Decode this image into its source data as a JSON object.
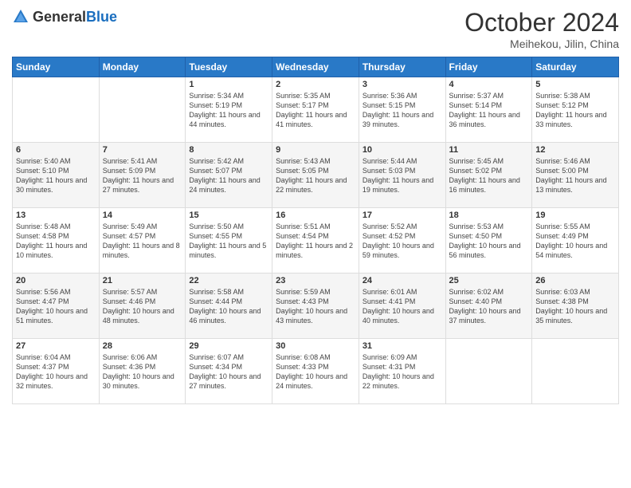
{
  "header": {
    "logo_general": "General",
    "logo_blue": "Blue",
    "title": "October 2024",
    "location": "Meihekou, Jilin, China"
  },
  "days_of_week": [
    "Sunday",
    "Monday",
    "Tuesday",
    "Wednesday",
    "Thursday",
    "Friday",
    "Saturday"
  ],
  "weeks": [
    [
      null,
      null,
      {
        "day": "1",
        "sunrise": "Sunrise: 5:34 AM",
        "sunset": "Sunset: 5:19 PM",
        "daylight": "Daylight: 11 hours and 44 minutes."
      },
      {
        "day": "2",
        "sunrise": "Sunrise: 5:35 AM",
        "sunset": "Sunset: 5:17 PM",
        "daylight": "Daylight: 11 hours and 41 minutes."
      },
      {
        "day": "3",
        "sunrise": "Sunrise: 5:36 AM",
        "sunset": "Sunset: 5:15 PM",
        "daylight": "Daylight: 11 hours and 39 minutes."
      },
      {
        "day": "4",
        "sunrise": "Sunrise: 5:37 AM",
        "sunset": "Sunset: 5:14 PM",
        "daylight": "Daylight: 11 hours and 36 minutes."
      },
      {
        "day": "5",
        "sunrise": "Sunrise: 5:38 AM",
        "sunset": "Sunset: 5:12 PM",
        "daylight": "Daylight: 11 hours and 33 minutes."
      }
    ],
    [
      {
        "day": "6",
        "sunrise": "Sunrise: 5:40 AM",
        "sunset": "Sunset: 5:10 PM",
        "daylight": "Daylight: 11 hours and 30 minutes."
      },
      {
        "day": "7",
        "sunrise": "Sunrise: 5:41 AM",
        "sunset": "Sunset: 5:09 PM",
        "daylight": "Daylight: 11 hours and 27 minutes."
      },
      {
        "day": "8",
        "sunrise": "Sunrise: 5:42 AM",
        "sunset": "Sunset: 5:07 PM",
        "daylight": "Daylight: 11 hours and 24 minutes."
      },
      {
        "day": "9",
        "sunrise": "Sunrise: 5:43 AM",
        "sunset": "Sunset: 5:05 PM",
        "daylight": "Daylight: 11 hours and 22 minutes."
      },
      {
        "day": "10",
        "sunrise": "Sunrise: 5:44 AM",
        "sunset": "Sunset: 5:03 PM",
        "daylight": "Daylight: 11 hours and 19 minutes."
      },
      {
        "day": "11",
        "sunrise": "Sunrise: 5:45 AM",
        "sunset": "Sunset: 5:02 PM",
        "daylight": "Daylight: 11 hours and 16 minutes."
      },
      {
        "day": "12",
        "sunrise": "Sunrise: 5:46 AM",
        "sunset": "Sunset: 5:00 PM",
        "daylight": "Daylight: 11 hours and 13 minutes."
      }
    ],
    [
      {
        "day": "13",
        "sunrise": "Sunrise: 5:48 AM",
        "sunset": "Sunset: 4:58 PM",
        "daylight": "Daylight: 11 hours and 10 minutes."
      },
      {
        "day": "14",
        "sunrise": "Sunrise: 5:49 AM",
        "sunset": "Sunset: 4:57 PM",
        "daylight": "Daylight: 11 hours and 8 minutes."
      },
      {
        "day": "15",
        "sunrise": "Sunrise: 5:50 AM",
        "sunset": "Sunset: 4:55 PM",
        "daylight": "Daylight: 11 hours and 5 minutes."
      },
      {
        "day": "16",
        "sunrise": "Sunrise: 5:51 AM",
        "sunset": "Sunset: 4:54 PM",
        "daylight": "Daylight: 11 hours and 2 minutes."
      },
      {
        "day": "17",
        "sunrise": "Sunrise: 5:52 AM",
        "sunset": "Sunset: 4:52 PM",
        "daylight": "Daylight: 10 hours and 59 minutes."
      },
      {
        "day": "18",
        "sunrise": "Sunrise: 5:53 AM",
        "sunset": "Sunset: 4:50 PM",
        "daylight": "Daylight: 10 hours and 56 minutes."
      },
      {
        "day": "19",
        "sunrise": "Sunrise: 5:55 AM",
        "sunset": "Sunset: 4:49 PM",
        "daylight": "Daylight: 10 hours and 54 minutes."
      }
    ],
    [
      {
        "day": "20",
        "sunrise": "Sunrise: 5:56 AM",
        "sunset": "Sunset: 4:47 PM",
        "daylight": "Daylight: 10 hours and 51 minutes."
      },
      {
        "day": "21",
        "sunrise": "Sunrise: 5:57 AM",
        "sunset": "Sunset: 4:46 PM",
        "daylight": "Daylight: 10 hours and 48 minutes."
      },
      {
        "day": "22",
        "sunrise": "Sunrise: 5:58 AM",
        "sunset": "Sunset: 4:44 PM",
        "daylight": "Daylight: 10 hours and 46 minutes."
      },
      {
        "day": "23",
        "sunrise": "Sunrise: 5:59 AM",
        "sunset": "Sunset: 4:43 PM",
        "daylight": "Daylight: 10 hours and 43 minutes."
      },
      {
        "day": "24",
        "sunrise": "Sunrise: 6:01 AM",
        "sunset": "Sunset: 4:41 PM",
        "daylight": "Daylight: 10 hours and 40 minutes."
      },
      {
        "day": "25",
        "sunrise": "Sunrise: 6:02 AM",
        "sunset": "Sunset: 4:40 PM",
        "daylight": "Daylight: 10 hours and 37 minutes."
      },
      {
        "day": "26",
        "sunrise": "Sunrise: 6:03 AM",
        "sunset": "Sunset: 4:38 PM",
        "daylight": "Daylight: 10 hours and 35 minutes."
      }
    ],
    [
      {
        "day": "27",
        "sunrise": "Sunrise: 6:04 AM",
        "sunset": "Sunset: 4:37 PM",
        "daylight": "Daylight: 10 hours and 32 minutes."
      },
      {
        "day": "28",
        "sunrise": "Sunrise: 6:06 AM",
        "sunset": "Sunset: 4:36 PM",
        "daylight": "Daylight: 10 hours and 30 minutes."
      },
      {
        "day": "29",
        "sunrise": "Sunrise: 6:07 AM",
        "sunset": "Sunset: 4:34 PM",
        "daylight": "Daylight: 10 hours and 27 minutes."
      },
      {
        "day": "30",
        "sunrise": "Sunrise: 6:08 AM",
        "sunset": "Sunset: 4:33 PM",
        "daylight": "Daylight: 10 hours and 24 minutes."
      },
      {
        "day": "31",
        "sunrise": "Sunrise: 6:09 AM",
        "sunset": "Sunset: 4:31 PM",
        "daylight": "Daylight: 10 hours and 22 minutes."
      },
      null,
      null
    ]
  ]
}
